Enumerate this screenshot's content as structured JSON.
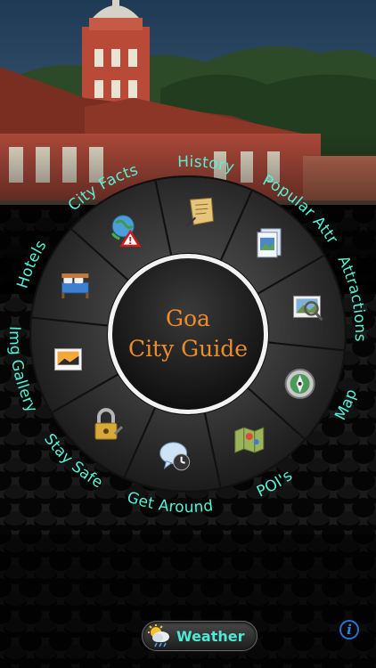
{
  "center": {
    "line1": "Goa",
    "line2": "City Guide"
  },
  "segments": [
    {
      "label": "History",
      "icon": "scroll-icon"
    },
    {
      "label": "Popular Attr",
      "icon": "photo-frame-icon"
    },
    {
      "label": "Attractions",
      "icon": "magnifier-photo-icon"
    },
    {
      "label": "Map",
      "icon": "compass-pin-icon"
    },
    {
      "label": "POI's",
      "icon": "map-pins-icon"
    },
    {
      "label": "Get Around",
      "icon": "chat-clock-icon"
    },
    {
      "label": "Stay Safe",
      "icon": "padlock-icon"
    },
    {
      "label": "Img Gallery",
      "icon": "picture-icon"
    },
    {
      "label": "Hotels",
      "icon": "bed-icon"
    },
    {
      "label": "City Facts",
      "icon": "warning-globe-icon"
    }
  ],
  "weather": {
    "label": "Weather",
    "icon": "sun-cloud-rain-icon"
  },
  "info": {
    "label": "i"
  },
  "colors": {
    "label": "#56f0d6",
    "title": "#ec8c2c",
    "info": "#2d6fd0"
  }
}
